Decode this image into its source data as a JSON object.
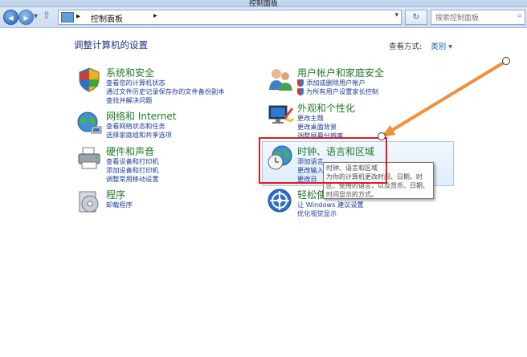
{
  "window": {
    "title": "控制面板"
  },
  "address": {
    "crumb_separator": "▸",
    "crumb": "控制面板",
    "crumb_arrow": "▸",
    "dropdown": "▾",
    "refresh_glyph": "↻",
    "back_glyph": "◀",
    "forward_glyph": "▶",
    "history_glyph": "▾",
    "up_glyph": "⇧",
    "search_placeholder": "搜索控制面板"
  },
  "header": {
    "heading": "调整计算机的设置",
    "view_by_label": "查看方式:",
    "view_by_value": "类别 ▾"
  },
  "left_categories": [
    {
      "title": "系统和安全",
      "links": [
        "查看您的计算机状态",
        "通过文件历史记录保存你的文件备份副本",
        "查找并解决问题"
      ],
      "icon": "shield-flag-icon"
    },
    {
      "title": "网络和 Internet",
      "links": [
        "查看网络状态和任务",
        "选择家庭组和共享选项"
      ],
      "icon": "network-globe-icon"
    },
    {
      "title": "硬件和声音",
      "links": [
        "查看设备和打印机",
        "添加设备和打印机",
        "调整常用移动设置"
      ],
      "icon": "printer-icon"
    },
    {
      "title": "程序",
      "links": [
        "卸载程序"
      ],
      "icon": "programs-disc-icon"
    }
  ],
  "right_categories": [
    {
      "title": "用户帐户和家庭安全",
      "links": [
        "添加或删除用户帐户",
        "为所有用户设置家长控制"
      ],
      "icon": "users-icon"
    },
    {
      "title": "外观和个性化",
      "links": [
        "更改主题",
        "更改桌面背景",
        "调整屏幕分辨率"
      ],
      "icon": "monitor-paint-icon"
    },
    {
      "title": "时钟、语言和区域",
      "links": [
        "添加语言",
        "更改输入",
        "更改日"
      ],
      "icon": "clock-globe-icon"
    },
    {
      "title": "轻松使",
      "links": [
        "让 Windows 建议设置",
        "优化视觉显示"
      ],
      "icon": "ease-of-access-icon"
    }
  ],
  "tooltip": {
    "lines": [
      "时钟、语言和区域",
      "为你的计算机更改时间、日期、时",
      "区、使用的语言，以及货币、日期、",
      "时间显示的方式。"
    ]
  },
  "annotation": {
    "arrow_color": "#f0903a",
    "box_color": "#e31c1c"
  }
}
